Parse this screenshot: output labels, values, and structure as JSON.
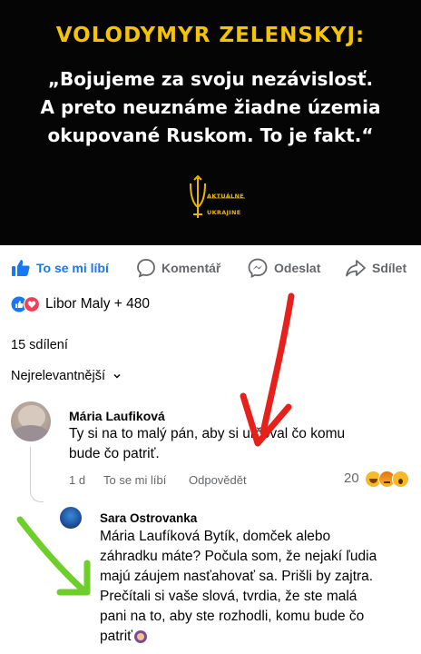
{
  "banner": {
    "title": "VOLODYMYR ZELENSKYJ:",
    "quote_line1": "„Bojujeme za svoju nezávislosť.",
    "quote_line2": "A preto neuznáme žiadne územia",
    "quote_line3": "okupované Ruskom. To je fakt.“",
    "logo_text_line1": "AKTUÁLNE",
    "logo_text_line2": "UKRAJINE"
  },
  "actions": {
    "like_label": "To se mi líbí",
    "comment_label": "Komentář",
    "send_label": "Odeslat",
    "share_label": "Sdílet"
  },
  "reactions": {
    "summary": "Libor Maly + 480"
  },
  "shares": {
    "count_label": "15 sdílení"
  },
  "sort": {
    "label": "Nejrelevantnější"
  },
  "comments": [
    {
      "author": "Mária Laufiková",
      "text_line1": "Ty si na to malý  pán,  aby si určoval čo komu",
      "text_line2": "bude  čo patriť.",
      "age": "1 d",
      "like_label": "To se mi líbí",
      "reply_label": "Odpovědět",
      "reaction_count": "20"
    },
    {
      "author": "Sara Ostrovanka",
      "text_line1": "Mária Laufíková Bytík, domček alebo",
      "text_line2": "záhradku máte? Počula som, že nejakí ľudia",
      "text_line3": "majú záujem nasťahovať sa. Prišli by zajtra.",
      "text_line4": "Prečítali si vaše slová, tvrdia, že ste malá",
      "text_line5": "pani na to, aby ste rozhodli, komu bude čo",
      "text_line6": "patriť"
    }
  ],
  "colors": {
    "facebook_blue": "#1877f2",
    "gold": "#f5c400",
    "red_arrow": "#e8201c",
    "green_arrow": "#6fcf2a"
  }
}
